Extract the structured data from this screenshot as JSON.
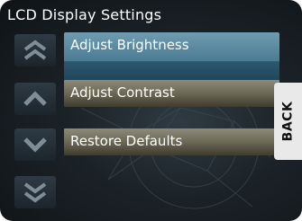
{
  "screen": {
    "title": "LCD Display Settings"
  },
  "nav": {
    "page_up_icon": "double-chevron-up-icon",
    "up_icon": "chevron-up-icon",
    "down_icon": "chevron-down-icon",
    "page_down_icon": "double-chevron-down-icon"
  },
  "menu": {
    "items": [
      {
        "label": "Adjust Brightness",
        "selected": true
      },
      {
        "label": "Adjust Contrast",
        "selected": false
      },
      {
        "label": "Restore Defaults",
        "selected": false
      }
    ]
  },
  "back": {
    "label": "BACK"
  },
  "colors": {
    "selected_item": "#4b7c93",
    "normal_item": "#6b6855",
    "background": "#1b2227",
    "nav_button": "#2e3a44",
    "back_button": "#e9e9e9"
  }
}
